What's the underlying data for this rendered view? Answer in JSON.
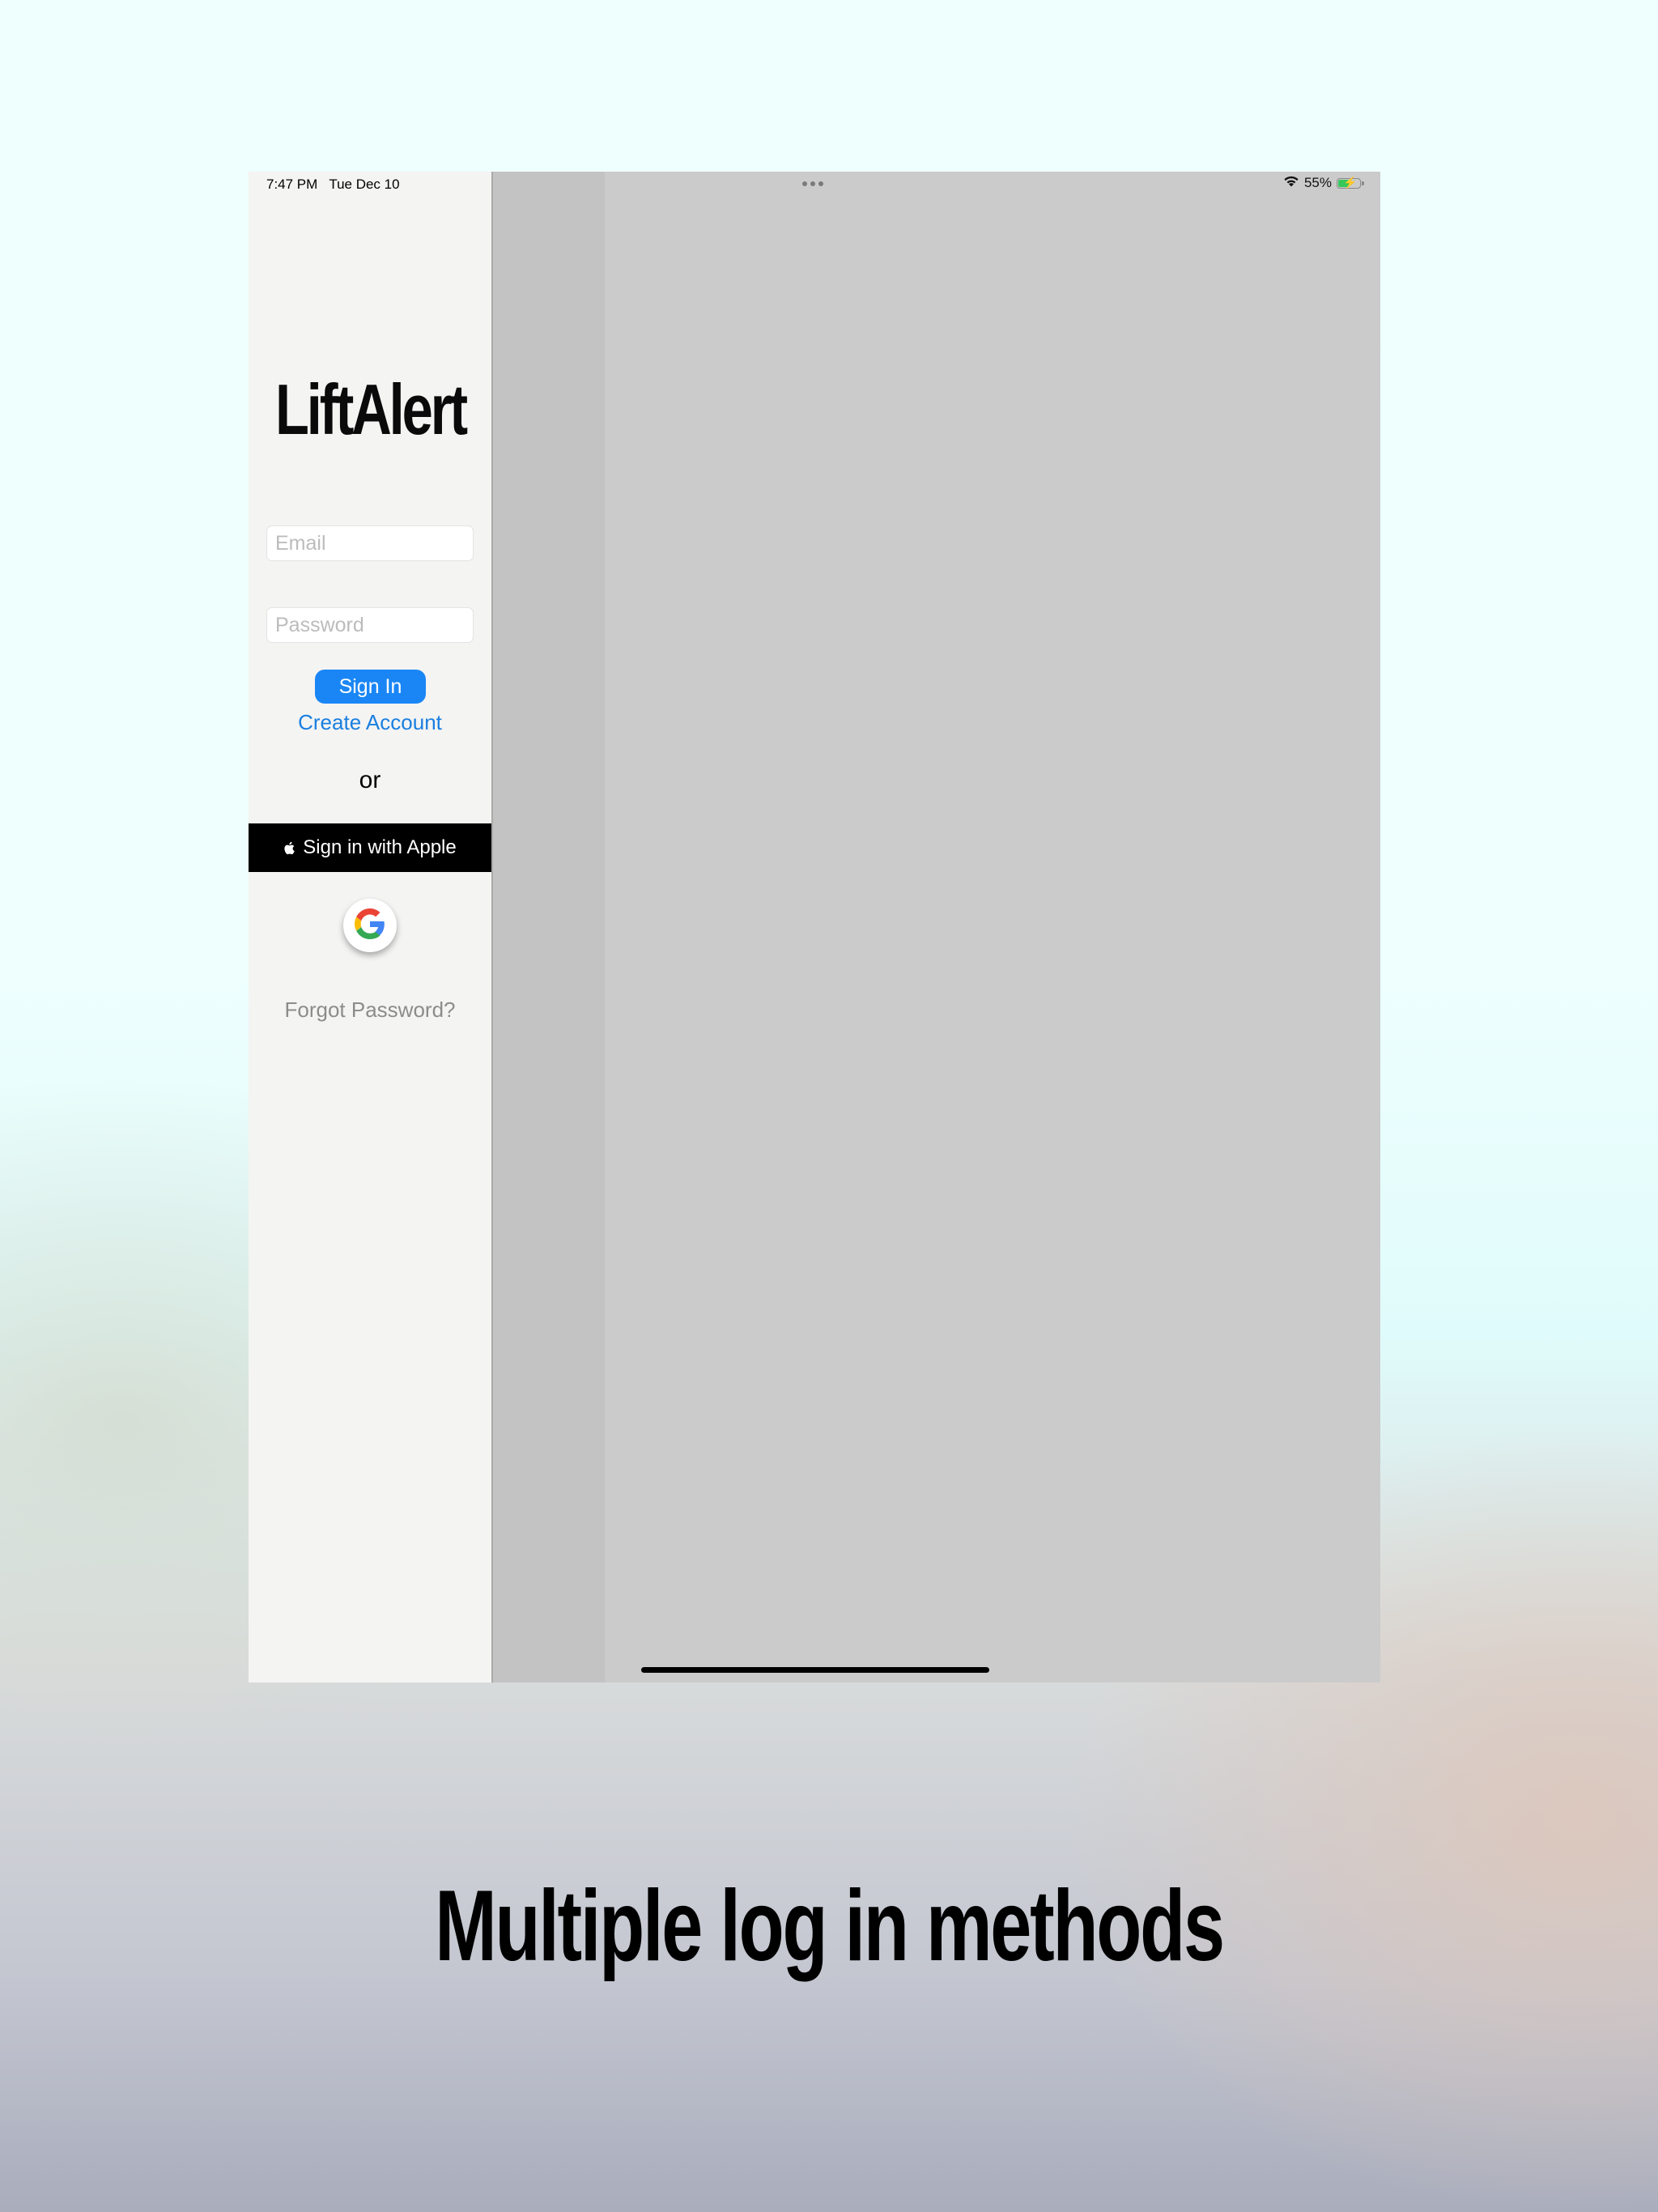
{
  "status_bar": {
    "time": "7:47 PM",
    "date": "Tue Dec 10",
    "battery_percent_label": "55%",
    "battery_level": 0.55,
    "icons": [
      "wifi-icon",
      "battery-charging-icon"
    ]
  },
  "login": {
    "app_title": "LiftAlert",
    "email_placeholder": "Email",
    "password_placeholder": "Password",
    "sign_in_label": "Sign In",
    "create_account_label": "Create Account",
    "or_label": "or",
    "apple_button_label": "Sign in with Apple",
    "google_button_icon": "google-g-icon",
    "forgot_password_label": "Forgot Password?"
  },
  "caption": "Multiple log in methods",
  "colors": {
    "accent_blue": "#1a86f5",
    "link_blue": "#1a7fe0",
    "apple_black": "#000000",
    "muted_gray": "#8c8c8c",
    "battery_green": "#35c759"
  }
}
